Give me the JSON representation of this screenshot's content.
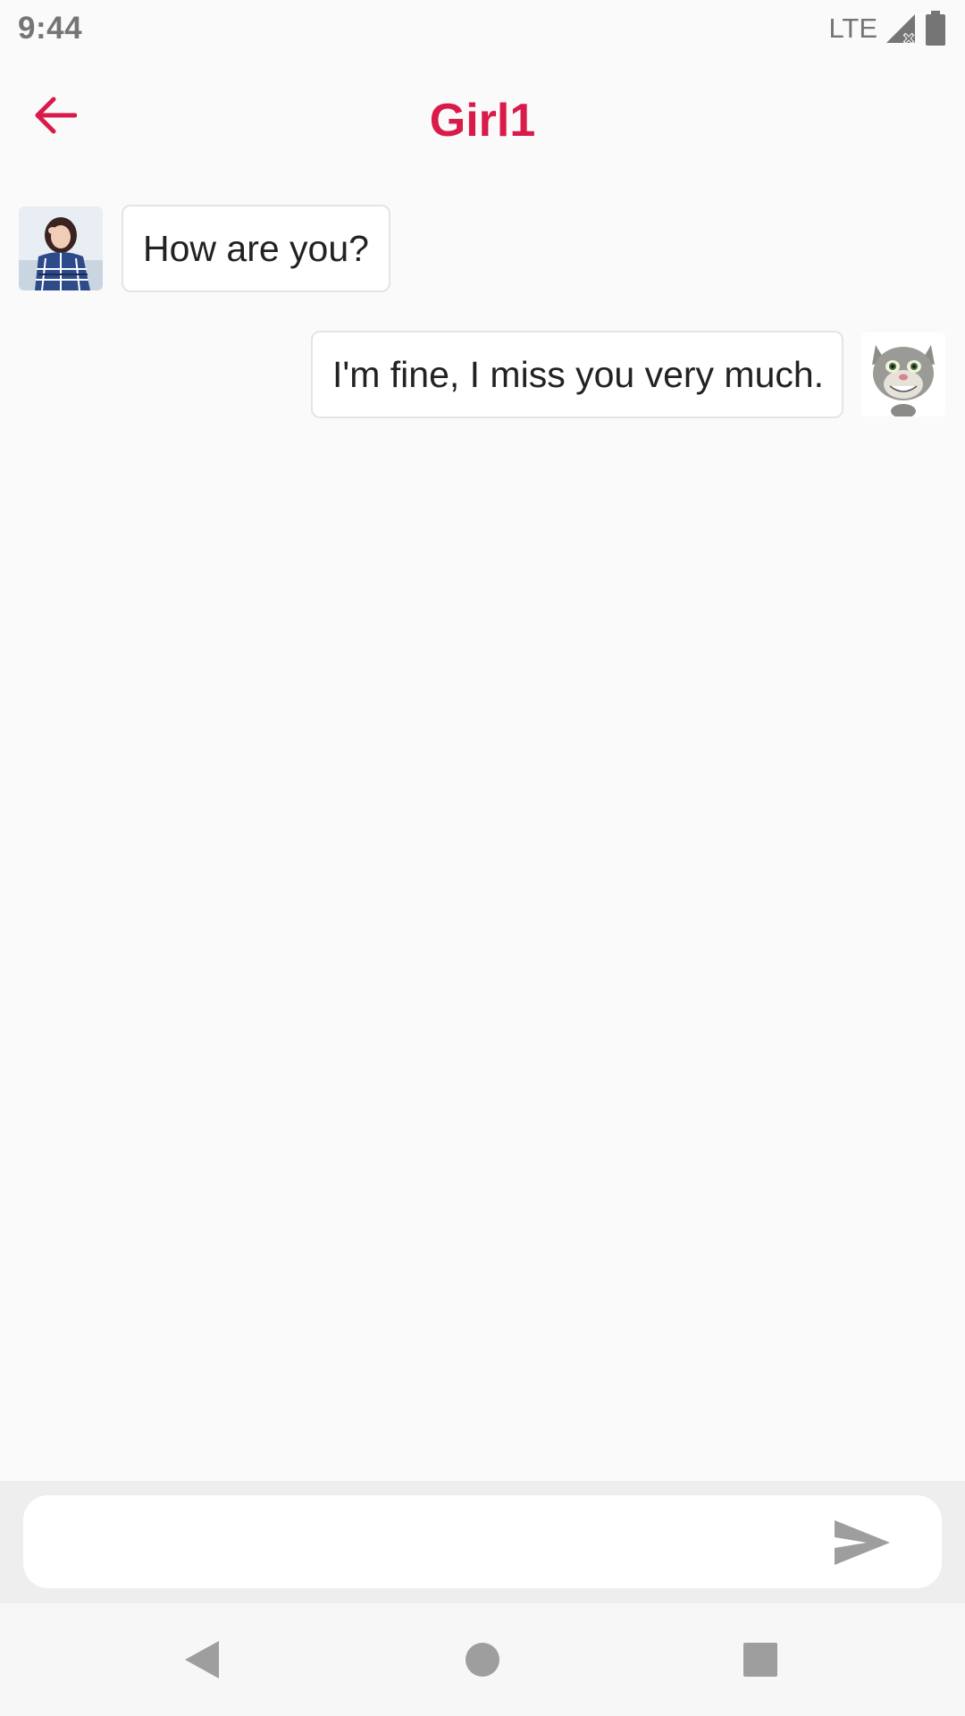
{
  "status_bar": {
    "time": "9:44",
    "network": "LTE",
    "icons": [
      "signal-no-service-icon",
      "battery-icon"
    ]
  },
  "toolbar": {
    "title": "Girl1",
    "back_icon": "arrow-left-icon",
    "accent_color": "#d81b4a"
  },
  "messages": [
    {
      "sender": "other",
      "text": "How are you?",
      "avatar": "girl-photo-avatar"
    },
    {
      "sender": "self",
      "text": "I'm fine, I miss you very much.",
      "avatar": "talking-cat-avatar"
    }
  ],
  "input": {
    "value": "",
    "placeholder": "",
    "send_icon": "send-icon"
  },
  "nav_bar": {
    "icons": [
      "back-triangle-icon",
      "home-circle-icon",
      "recents-square-icon"
    ]
  }
}
